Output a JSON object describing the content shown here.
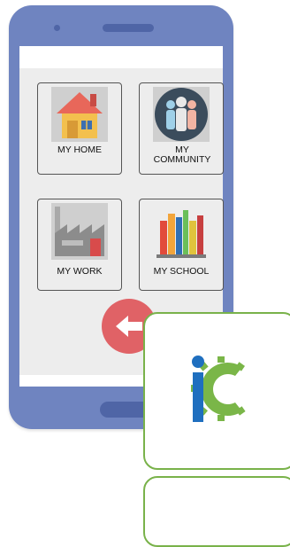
{
  "tiles": [
    {
      "label": "MY HOME",
      "icon": "house-icon"
    },
    {
      "label": "MY COMMUNITY",
      "icon": "people-icon"
    },
    {
      "label": "MY WORK",
      "icon": "factory-icon"
    },
    {
      "label": "MY SCHOOL",
      "icon": "books-icon"
    }
  ],
  "back_button": {
    "icon": "arrow-left-icon"
  },
  "logo": {
    "name": "ic-logo",
    "colors": {
      "blue": "#1f6fbf",
      "green": "#7ab648"
    }
  },
  "colors": {
    "phone_body": "#6f84c0",
    "phone_details": "#4f65a6",
    "app_background": "#ededed",
    "back_button": "#e06266",
    "badge_border": "#79b24a"
  }
}
